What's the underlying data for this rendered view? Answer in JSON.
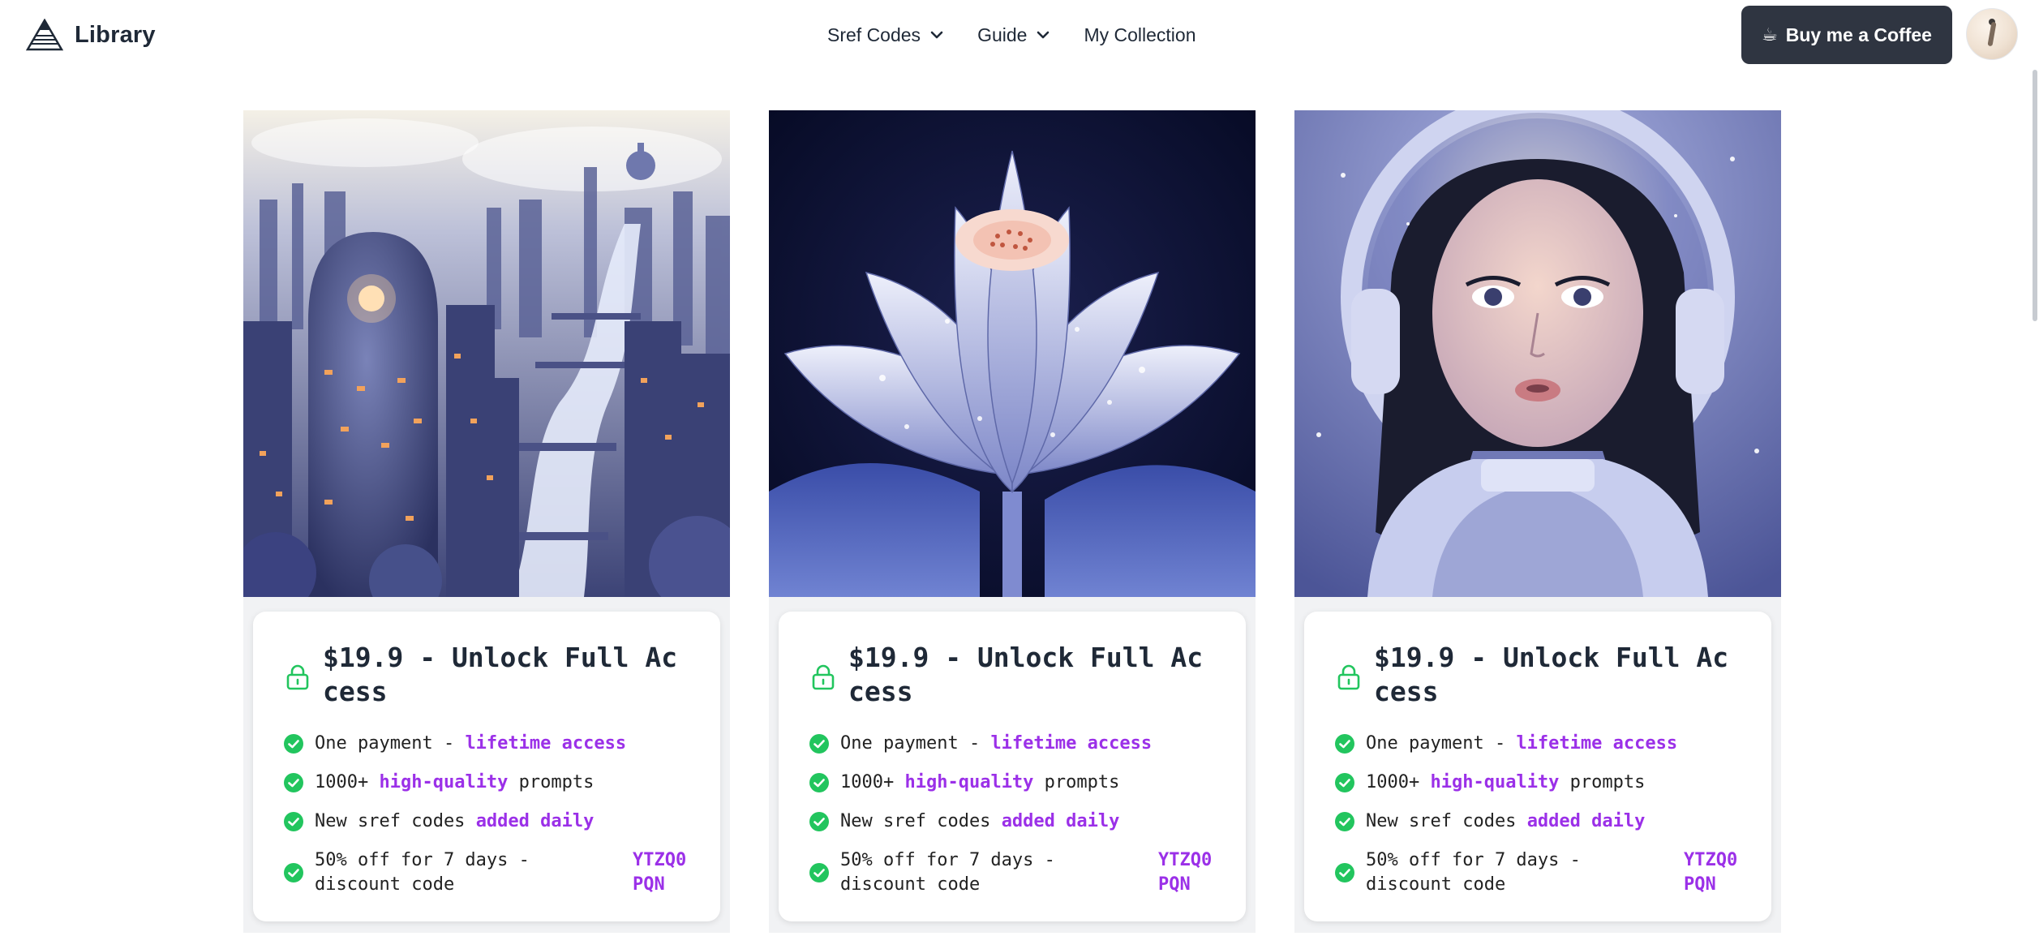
{
  "header": {
    "brand": "Library",
    "nav": [
      {
        "label": "Sref Codes",
        "has_dropdown": true
      },
      {
        "label": "Guide",
        "has_dropdown": true
      },
      {
        "label": "My Collection",
        "has_dropdown": false
      }
    ],
    "coffee_icon": "☕",
    "coffee_label": "Buy me a Coffee"
  },
  "colors": {
    "accent": "#9b30e8",
    "success": "#22c55e",
    "button_dark": "#2f3541"
  },
  "cards": [
    {
      "image": "futuristic-city-art",
      "title": "$19.9 - Unlock Full Access",
      "f1_a": "One payment - ",
      "f1_b": "lifetime access",
      "f2_a": "1000+ ",
      "f2_b": "high-quality",
      "f2_c": " prompts",
      "f3_a": "New sref codes ",
      "f3_b": "added daily",
      "f4_a": "50% off for 7 days - discount code",
      "f4_code": "YTZQ0PQN"
    },
    {
      "image": "lotus-flower-art",
      "title": "$19.9 - Unlock Full Access",
      "f1_a": "One payment - ",
      "f1_b": "lifetime access",
      "f2_a": "1000+ ",
      "f2_b": "high-quality",
      "f2_c": " prompts",
      "f3_a": "New sref codes ",
      "f3_b": "added daily",
      "f4_a": "50% off for 7 days - discount code",
      "f4_code": "YTZQ0PQN"
    },
    {
      "image": "astronaut-girl-art",
      "title": "$19.9 - Unlock Full Access",
      "f1_a": "One payment - ",
      "f1_b": "lifetime access",
      "f2_a": "1000+ ",
      "f2_b": "high-quality",
      "f2_c": " prompts",
      "f3_a": "New sref codes ",
      "f3_b": "added daily",
      "f4_a": "50% off for 7 days - discount code",
      "f4_code": "YTZQ0PQN"
    }
  ]
}
